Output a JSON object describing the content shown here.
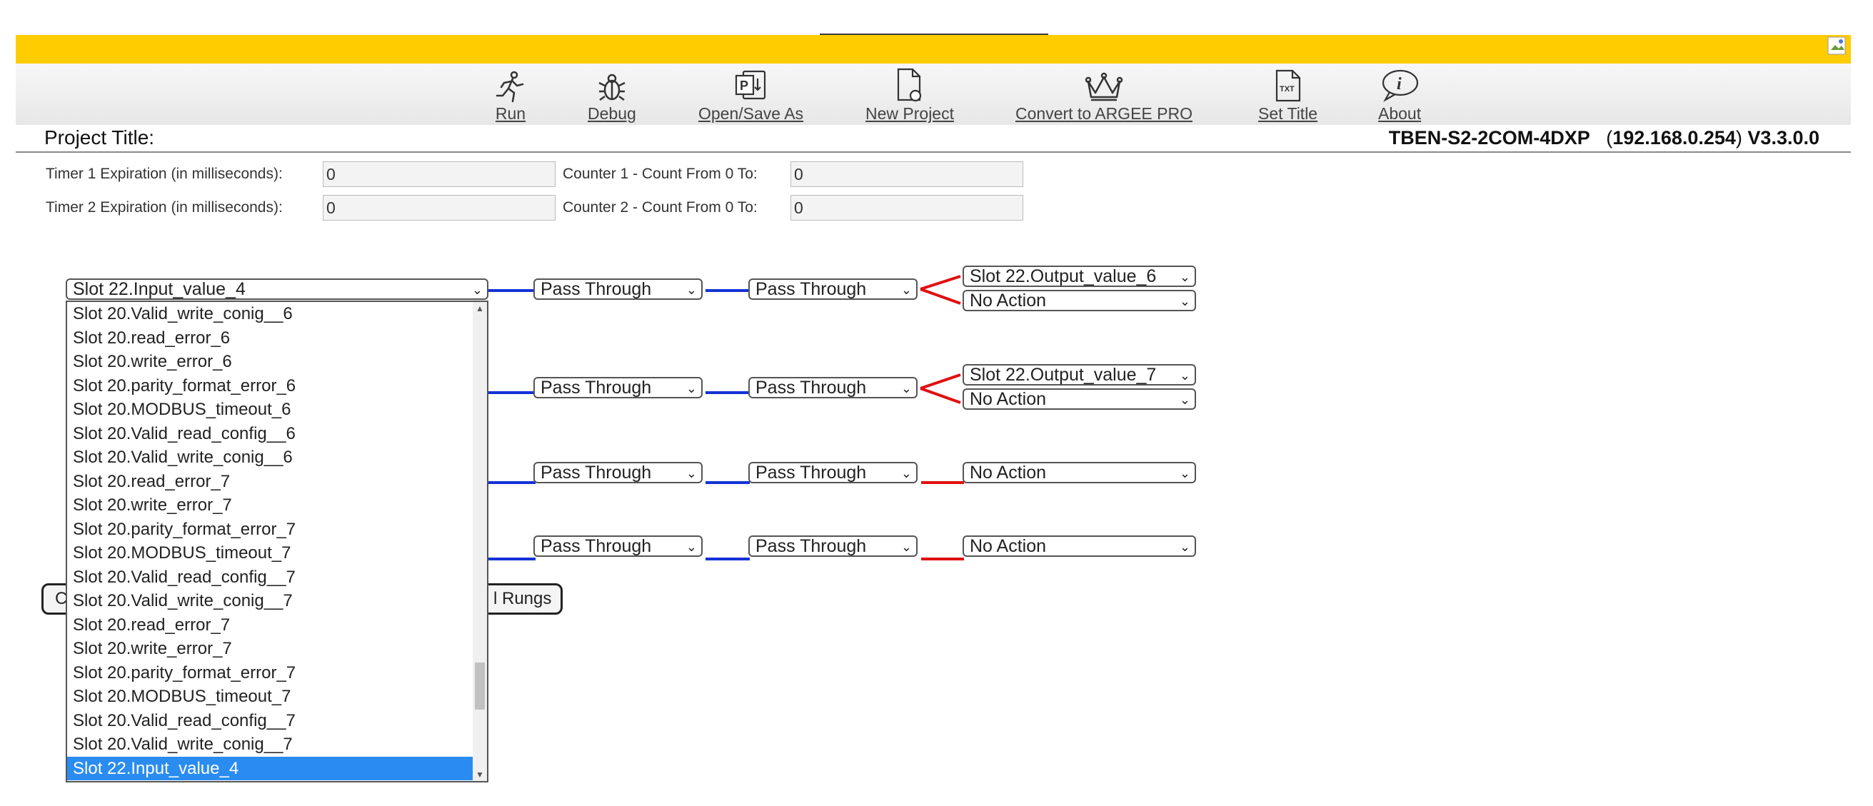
{
  "toolbar": {
    "run": {
      "label": "Run",
      "icon": "running-figure-icon"
    },
    "debug": {
      "label": "Debug",
      "icon": "bug-icon"
    },
    "open_save": {
      "label": "Open/Save As",
      "icon": "powerpoint-file-icon"
    },
    "new_project": {
      "label": "New Project",
      "icon": "new-file-icon"
    },
    "convert": {
      "label": "Convert to ARGEE PRO",
      "icon": "crown-icon"
    },
    "set_title": {
      "label": "Set Title",
      "icon": "txt-file-icon"
    },
    "about": {
      "label": "About",
      "icon": "info-bubble-icon"
    }
  },
  "project": {
    "title_label": "Project Title:"
  },
  "device": {
    "model": "TBEN-S2-2COM-4DXP",
    "ip": "192.168.0.254",
    "version": "V3.3.0.0"
  },
  "timers": [
    {
      "label": "Timer 1 Expiration (in milliseconds):",
      "value": "0"
    },
    {
      "label": "Timer 2 Expiration (in milliseconds):",
      "value": "0"
    }
  ],
  "counters": [
    {
      "label": "Counter 1 - Count From 0 To:",
      "value": "0"
    },
    {
      "label": "Counter 2 - Count From 0 To:",
      "value": "0"
    }
  ],
  "rungs": [
    {
      "input": "Slot 22.Input_value_4",
      "f1": "Pass Through",
      "f2": "Pass Through",
      "outputs": [
        "Slot 22.Output_value_6",
        "No Action"
      ]
    },
    {
      "input": "",
      "f1": "Pass Through",
      "f2": "Pass Through",
      "outputs": [
        "Slot 22.Output_value_7",
        "No Action"
      ]
    },
    {
      "input": "",
      "f1": "Pass Through",
      "f2": "Pass Through",
      "outputs": [
        "No Action"
      ]
    },
    {
      "input": "",
      "f1": "Pass Through",
      "f2": "Pass Through",
      "outputs": [
        "No Action"
      ]
    }
  ],
  "buttons": {
    "left_partial": "C",
    "rungs_partial": "l Rungs"
  },
  "dropdown": {
    "options": [
      "Slot 20.Valid_write_conig__6",
      "Slot 20.read_error_6",
      "Slot 20.write_error_6",
      "Slot 20.parity_format_error_6",
      "Slot 20.MODBUS_timeout_6",
      "Slot 20.Valid_read_config__6",
      "Slot 20.Valid_write_conig__6",
      "Slot 20.read_error_7",
      "Slot 20.write_error_7",
      "Slot 20.parity_format_error_7",
      "Slot 20.MODBUS_timeout_7",
      "Slot 20.Valid_read_config__7",
      "Slot 20.Valid_write_conig__7",
      "Slot 20.read_error_7",
      "Slot 20.write_error_7",
      "Slot 20.parity_format_error_7",
      "Slot 20.MODBUS_timeout_7",
      "Slot 20.Valid_read_config__7",
      "Slot 20.Valid_write_conig__7",
      "Slot 22.Input_value_4"
    ],
    "selected": "Slot 22.Input_value_4"
  },
  "colors": {
    "banner": "#ffcc00",
    "wire_blue": "#1432d6",
    "wire_red": "#e01010",
    "highlight": "#2a8cf0"
  }
}
